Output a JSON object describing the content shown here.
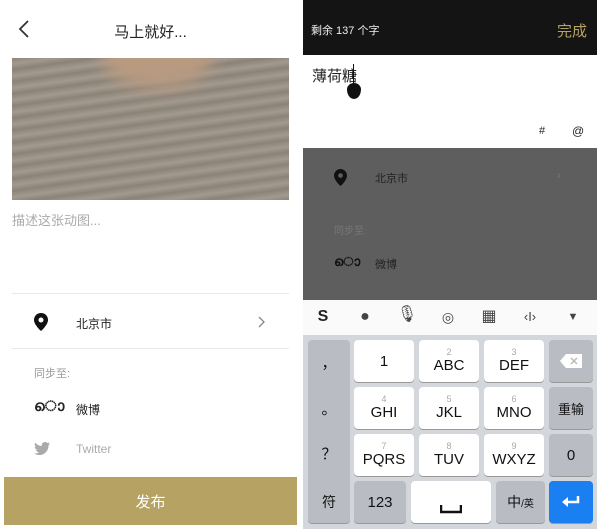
{
  "left": {
    "title": "马上就好...",
    "description_placeholder": "描述这张动图...",
    "location": "北京市",
    "sync_label": "同步至:",
    "sync_items": [
      {
        "label": "微博",
        "icon": "weibo-icon"
      },
      {
        "label": "Twitter",
        "icon": "twitter-icon"
      }
    ],
    "publish_label": "发布",
    "accent": "#b6a263"
  },
  "right": {
    "remaining": "剩余 137 个字",
    "done_label": "完成",
    "input_text": "薄荷糖",
    "hash_label": "#",
    "at_label": "@",
    "location": "北京市",
    "sync_label": "同步至:",
    "weibo_label": "微博",
    "keyboard": {
      "punct": [
        "，",
        "。",
        "？",
        "！"
      ],
      "keys": [
        {
          "num": "",
          "label": "1"
        },
        {
          "num": "2",
          "label": "ABC"
        },
        {
          "num": "3",
          "label": "DEF"
        },
        {
          "num": "4",
          "label": "GHI"
        },
        {
          "num": "5",
          "label": "JKL"
        },
        {
          "num": "6",
          "label": "MNO"
        },
        {
          "num": "7",
          "label": "PQRS"
        },
        {
          "num": "8",
          "label": "TUV"
        },
        {
          "num": "9",
          "label": "WXYZ"
        }
      ],
      "reenter": "重输",
      "zero": "0",
      "symbols": "符",
      "num_mode": "123",
      "lang_zh": "中",
      "lang_en": "/英",
      "enter_color": "#1a7ff0"
    }
  }
}
